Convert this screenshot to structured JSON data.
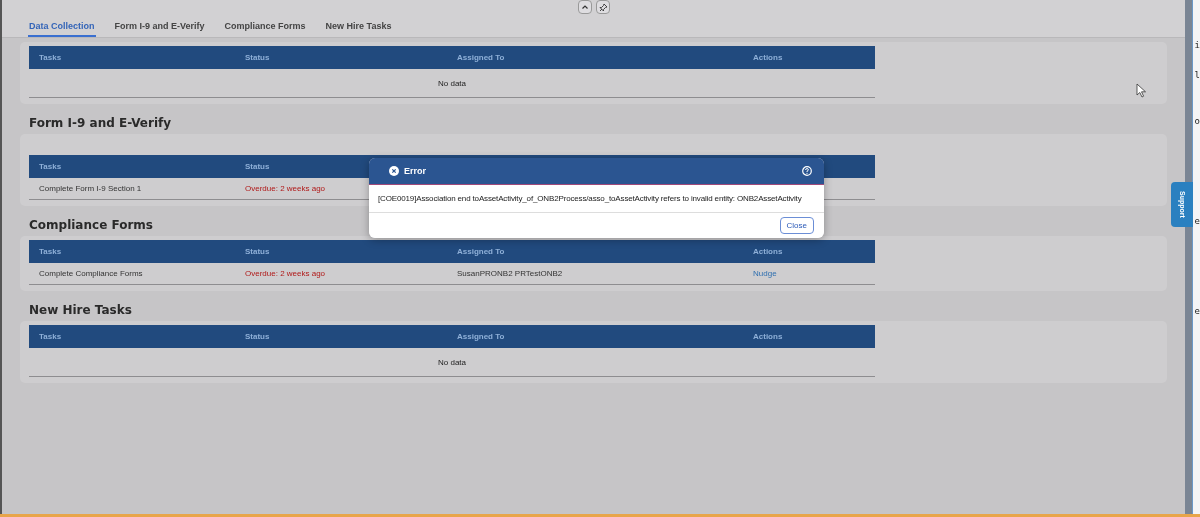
{
  "tabs": [
    {
      "label": "Data Collection",
      "selected": true
    },
    {
      "label": "Form I-9 and E-Verify",
      "selected": false
    },
    {
      "label": "Compliance Forms",
      "selected": false
    },
    {
      "label": "New Hire Tasks",
      "selected": false
    }
  ],
  "sections": [
    {
      "columns": [
        "Tasks",
        "Status",
        "Assigned To",
        "Actions"
      ],
      "empty_text": "No data"
    },
    {
      "title": "Form I-9 and E-Verify",
      "columns": [
        "Tasks",
        "Status"
      ],
      "rows": [
        [
          {
            "kind": "text",
            "text": "Complete Form I-9 Section 1"
          },
          {
            "kind": "overdue",
            "text": "Overdue: 2 weeks ago"
          }
        ]
      ]
    },
    {
      "title": "Compliance Forms",
      "columns": [
        "Tasks",
        "Status",
        "Assigned To",
        "Actions"
      ],
      "rows": [
        [
          {
            "kind": "text",
            "text": "Complete Compliance Forms"
          },
          {
            "kind": "overdue",
            "text": "Overdue: 2 weeks ago"
          },
          {
            "kind": "text",
            "text": "SusanPRONB2 PRTestONB2"
          },
          {
            "kind": "link",
            "text": "Nudge"
          }
        ]
      ]
    },
    {
      "title": "New Hire Tasks",
      "columns": [
        "Tasks",
        "Status",
        "Assigned To",
        "Actions"
      ],
      "empty_text": "No data"
    }
  ],
  "dialog": {
    "title": "Error",
    "message": "[COE0019]Association end toAssetActivity_of_ONB2Process/asso_toAssetActivity refers to invalid entity: ONB2AssetActivity",
    "button": "Close"
  },
  "support_tab": "Support",
  "side_fragments": [
    "i",
    "l",
    "o",
    "e",
    "e"
  ]
}
